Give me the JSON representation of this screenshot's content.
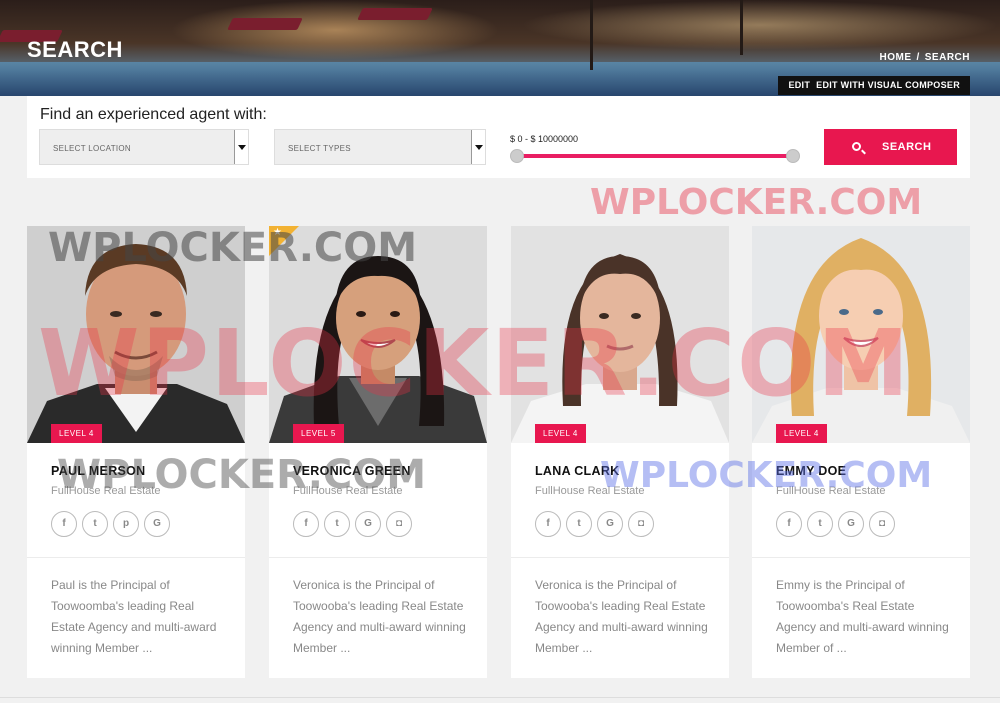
{
  "hero": {
    "title": "SEARCH",
    "breadcrumb": {
      "home": "HOME",
      "separator": "/",
      "current": "SEARCH"
    },
    "edit_bar": {
      "edit": "EDIT",
      "visual_composer": "EDIT WITH VISUAL COMPOSER"
    }
  },
  "search": {
    "heading": "Find an experienced agent with:",
    "location_select": "SELECT LOCATION",
    "types_select": "SELECT TYPES",
    "price_range_label": "$ 0 - $ 10000000",
    "price_min": 0,
    "price_max": 10000000,
    "button_label": "SEARCH"
  },
  "watermark": "WPLOCKER.COM",
  "agents": [
    {
      "name": "PAUL MERSON",
      "company": "FullHouse Real Estate",
      "level": "LEVEL 4",
      "featured": false,
      "socials": [
        {
          "icon": "facebook-icon",
          "glyph": "f"
        },
        {
          "icon": "twitter-icon",
          "glyph": "t"
        },
        {
          "icon": "pinterest-icon",
          "glyph": "p"
        },
        {
          "icon": "google-icon",
          "glyph": "G"
        }
      ],
      "description": "Paul is the Principal of Toowoomba's leading Real Estate Agency and multi-award winning Member ..."
    },
    {
      "name": "VERONICA GREEN",
      "company": "FullHouse Real Estate",
      "level": "LEVEL 5",
      "featured": true,
      "socials": [
        {
          "icon": "facebook-icon",
          "glyph": "f"
        },
        {
          "icon": "twitter-icon",
          "glyph": "t"
        },
        {
          "icon": "google-icon",
          "glyph": "G"
        },
        {
          "icon": "instagram-icon",
          "glyph": "◘"
        }
      ],
      "description": "Veronica is the Principal of Toowooba's leading Real Estate Agency and multi-award winning Member ..."
    },
    {
      "name": "LANA CLARK",
      "company": "FullHouse Real Estate",
      "level": "LEVEL 4",
      "featured": false,
      "socials": [
        {
          "icon": "facebook-icon",
          "glyph": "f"
        },
        {
          "icon": "twitter-icon",
          "glyph": "t"
        },
        {
          "icon": "google-icon",
          "glyph": "G"
        },
        {
          "icon": "instagram-icon",
          "glyph": "◘"
        }
      ],
      "description": "Veronica is the Principal of Toowooba's leading Real Estate Agency and multi-award winning Member ..."
    },
    {
      "name": "EMMY DOE",
      "company": "FullHouse Real Estate",
      "level": "LEVEL 4",
      "featured": false,
      "socials": [
        {
          "icon": "facebook-icon",
          "glyph": "f"
        },
        {
          "icon": "twitter-icon",
          "glyph": "t"
        },
        {
          "icon": "google-icon",
          "glyph": "G"
        },
        {
          "icon": "instagram-icon",
          "glyph": "◘"
        }
      ],
      "description": "Emmy is the Principal of Toowoomba's Real Estate Agency and multi-award winning Member of ..."
    }
  ],
  "colors": {
    "accent": "#e8174f",
    "featured_star": "#f2b233",
    "muted_text": "#888888"
  }
}
